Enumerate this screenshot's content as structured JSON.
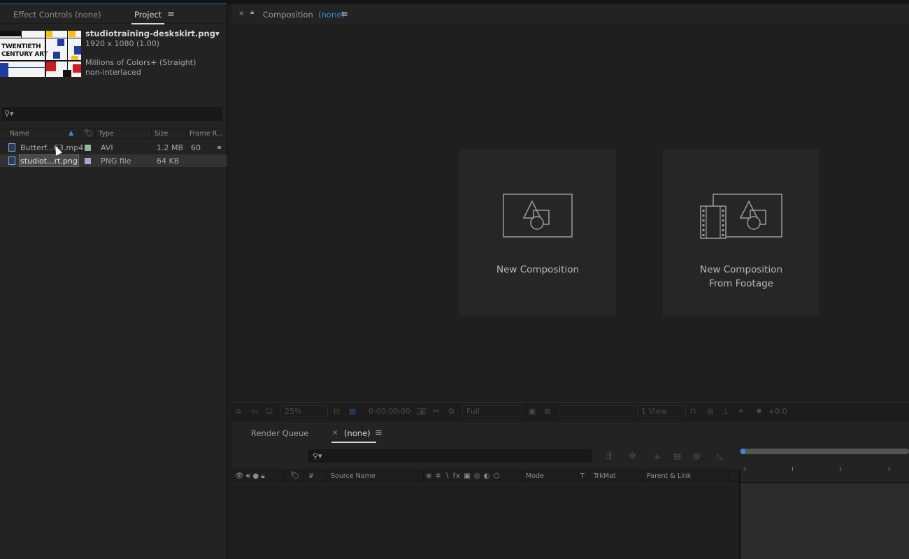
{
  "project_panel": {
    "tabs": {
      "effect_controls": "Effect Controls (none)",
      "project": "Project"
    },
    "menu_glyph": "≡",
    "thumbnail_text": {
      "line1": "TWENTIETH",
      "line2": "CENTURY ART"
    },
    "selected_file": {
      "name": "studiotraining-deskskirt.png▾",
      "dimensions": "1920 x 1080 (1.00)",
      "color_depth": "Millions of Colors+ (Straight)",
      "interlace": "non-interlaced"
    },
    "search_icon": "⚲▾",
    "columns": {
      "name": "Name",
      "type": "Type",
      "size": "Size",
      "frame_rate": "Frame R..."
    },
    "items": [
      {
        "name": "Butterf...63.mp4",
        "type": "AVI",
        "size": "1.2 MB",
        "frame_rate": "60",
        "label_color": "#8fb8a0"
      },
      {
        "name": "studiot...rt.png",
        "type": "PNG file",
        "size": "64 KB",
        "frame_rate": "",
        "label_color": "#a9a6cf"
      }
    ]
  },
  "composition_panel": {
    "close": "×",
    "lock": "🔒",
    "title": "Composition",
    "comp_name": "(none)",
    "menu_glyph": "≡",
    "new_composition": "New Composition",
    "new_from_footage_line1": "New Composition",
    "new_from_footage_line2": "From Footage",
    "toolbar": {
      "zoom": "25%",
      "timecode": "0:00:00:00",
      "resolution": "Full",
      "views": "1 View",
      "exposure": "+0.0"
    }
  },
  "timeline_panel": {
    "tabs": {
      "render_queue": "Render Queue",
      "comp": "(none)"
    },
    "close": "×",
    "menu_glyph": "≡",
    "search_icon": "⚲▾",
    "header": {
      "number": "#",
      "source_name": "Source Name",
      "mode": "Mode",
      "t": "T",
      "trkmat": "TrkMat",
      "parent": "Parent & Link"
    },
    "switch_glyphs": "⊕ ✲ ∖ fx ▣ ◎ ◐ ⬡",
    "av_glyphs": "👁 🔊 ● 🔒"
  }
}
